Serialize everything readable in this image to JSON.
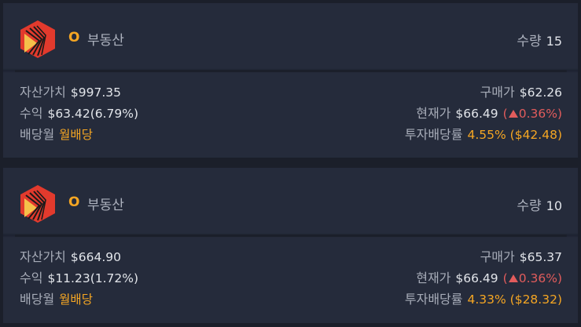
{
  "colors": {
    "background": "#1b1f2a",
    "card": "#252b3b",
    "accent": "#f5a623",
    "up": "#e25c5c",
    "logo_red": "#e23a2d"
  },
  "holdings": [
    {
      "icon": "realty-income-logo-icon",
      "ticker": "O",
      "sector": "부동산",
      "quantity_label": "수량",
      "quantity": "15",
      "asset_value_label": "자산가치",
      "asset_value": "$997.35",
      "profit_label": "수익",
      "profit": "$63.42(6.79%)",
      "dividend_month_label": "배당월",
      "dividend_month": "월배당",
      "buy_price_label": "구매가",
      "buy_price": "$62.26",
      "current_price_label": "현재가",
      "current_price": "$66.49",
      "change_open": "(",
      "change": "0.36%)",
      "yield_label": "투자배당률",
      "yield": "4.55% ($42.48)"
    },
    {
      "icon": "realty-income-logo-icon",
      "ticker": "O",
      "sector": "부동산",
      "quantity_label": "수량",
      "quantity": "10",
      "asset_value_label": "자산가치",
      "asset_value": "$664.90",
      "profit_label": "수익",
      "profit": "$11.23(1.72%)",
      "dividend_month_label": "배당월",
      "dividend_month": "월배당",
      "buy_price_label": "구매가",
      "buy_price": "$65.37",
      "current_price_label": "현재가",
      "current_price": "$66.49",
      "change_open": "(",
      "change": "0.36%)",
      "yield_label": "투자배당률",
      "yield": "4.33% ($28.32)"
    }
  ]
}
